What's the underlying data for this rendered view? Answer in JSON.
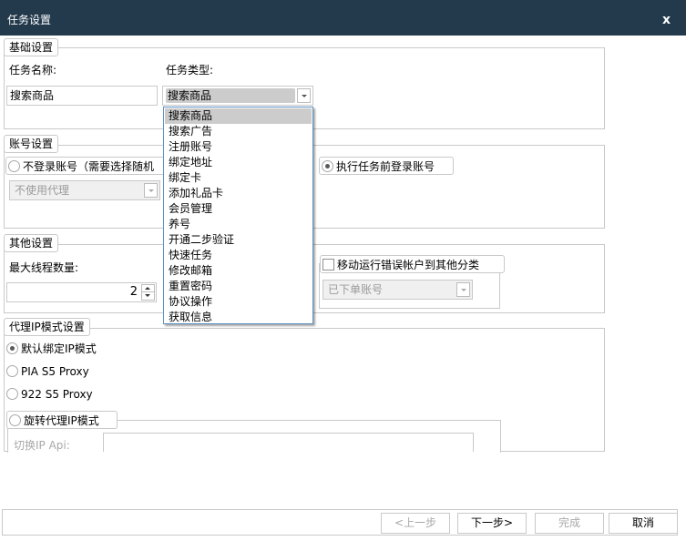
{
  "window": {
    "title": "任务设置",
    "close_glyph": "x",
    "close_icon": "close-icon"
  },
  "basic": {
    "legend": "基础设置",
    "name_label": "任务名称:",
    "name_value": "搜索商品",
    "type_label": "任务类型:",
    "type_value": "搜索商品",
    "type_options": [
      {
        "label": "搜索商品",
        "selected": true
      },
      {
        "label": "搜索广告",
        "selected": false
      },
      {
        "label": "注册账号",
        "selected": false
      },
      {
        "label": "绑定地址",
        "selected": false
      },
      {
        "label": "绑定卡",
        "selected": false
      },
      {
        "label": "添加礼品卡",
        "selected": false
      },
      {
        "label": "会员管理",
        "selected": false
      },
      {
        "label": "养号",
        "selected": false
      },
      {
        "label": "开通二步验证",
        "selected": false
      },
      {
        "label": "快速任务",
        "selected": false
      },
      {
        "label": "修改邮箱",
        "selected": false
      },
      {
        "label": "重置密码",
        "selected": false
      },
      {
        "label": "协议操作",
        "selected": false
      },
      {
        "label": "获取信息",
        "selected": false
      }
    ]
  },
  "account": {
    "legend": "账号设置",
    "no_login_label": "不登录账号（需要选择随机",
    "no_login_checked": false,
    "proxy_value": "不使用代理",
    "login_before_label": "执行任务前登录账号",
    "login_before_checked": true
  },
  "other": {
    "legend": "其他设置",
    "max_threads_label": "最大线程数量:",
    "max_threads_value": "2",
    "move_error_label": "移动运行错误帐户到其他分类",
    "move_error_checked": false,
    "category_value": "已下单账号"
  },
  "proxy": {
    "legend": "代理IP模式设置",
    "options": [
      {
        "label": "默认绑定IP模式",
        "checked": true
      },
      {
        "label": "PIA S5 Proxy",
        "checked": false
      },
      {
        "label": "922 S5 Proxy",
        "checked": false
      }
    ],
    "rotate_label": "旋转代理IP模式",
    "rotate_checked": false,
    "switch_api_label": "切换IP Api:",
    "switch_api_value": ""
  },
  "footer": {
    "prev_label": "<上一步",
    "prev_enabled": false,
    "next_label": "下一步>",
    "next_enabled": true,
    "finish_label": "完成",
    "finish_enabled": false,
    "cancel_label": "取消",
    "cancel_enabled": true
  }
}
